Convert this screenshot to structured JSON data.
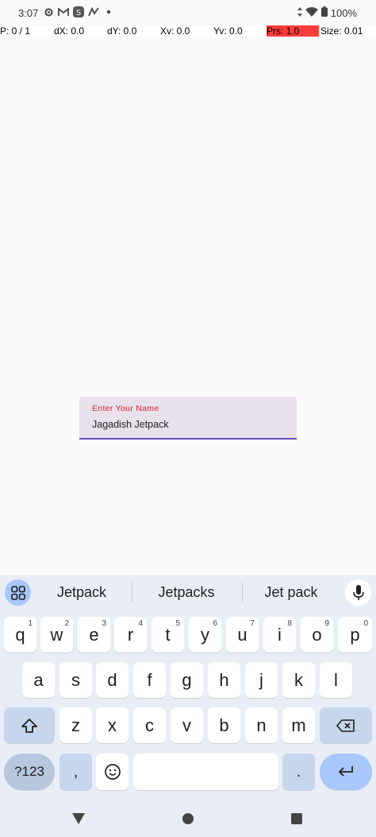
{
  "status_bar": {
    "time": "3:07",
    "left_icons": [
      "settings-icon",
      "gmail-icon",
      "s-app-icon",
      "pen-icon",
      "dot-icon"
    ],
    "battery": "100%"
  },
  "pointer": {
    "p": "P: 0 / 1",
    "dx": "dX: 0.0",
    "dy": "dY: 0.0",
    "xv": "Xv: 0.0",
    "yv": "Yv: 0.0",
    "prs": "Prs: 1.0",
    "size": "Size: 0.01",
    "prs_color": "#ff3b3b"
  },
  "form": {
    "label": "Enter Your Name",
    "value": "Jagadish Jetpack",
    "label_color": "#d8232a",
    "indicator_color": "#6a4fb4"
  },
  "keyboard": {
    "suggestions": [
      "Jetpack",
      "Jetpacks",
      "Jet pack"
    ],
    "row1": [
      {
        "k": "q",
        "h": "1"
      },
      {
        "k": "w",
        "h": "2"
      },
      {
        "k": "e",
        "h": "3"
      },
      {
        "k": "r",
        "h": "4"
      },
      {
        "k": "t",
        "h": "5"
      },
      {
        "k": "y",
        "h": "6"
      },
      {
        "k": "u",
        "h": "7"
      },
      {
        "k": "i",
        "h": "8"
      },
      {
        "k": "o",
        "h": "9"
      },
      {
        "k": "p",
        "h": "0"
      }
    ],
    "row2": [
      "a",
      "s",
      "d",
      "f",
      "g",
      "h",
      "j",
      "k",
      "l"
    ],
    "row3": [
      "z",
      "x",
      "c",
      "v",
      "b",
      "n",
      "m"
    ],
    "symbols_label": "?123",
    "comma_label": ",",
    "period_label": ".",
    "accent_color": "#a8c7fa"
  }
}
